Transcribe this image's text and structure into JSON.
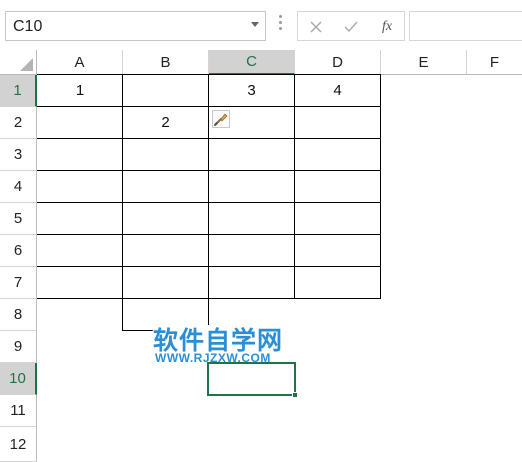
{
  "formula_bar": {
    "name_box_value": "C10",
    "fx_label": "fx",
    "formula_value": ""
  },
  "columns": [
    {
      "label": "A",
      "active": false
    },
    {
      "label": "B",
      "active": false
    },
    {
      "label": "C",
      "active": true
    },
    {
      "label": "D",
      "active": false
    },
    {
      "label": "E",
      "active": false
    },
    {
      "label": "F",
      "active": false
    }
  ],
  "rows": [
    {
      "label": "1",
      "active": true
    },
    {
      "label": "2",
      "active": false
    },
    {
      "label": "3",
      "active": false
    },
    {
      "label": "4",
      "active": false
    },
    {
      "label": "5",
      "active": false
    },
    {
      "label": "6",
      "active": false
    },
    {
      "label": "7",
      "active": false
    },
    {
      "label": "8",
      "active": false
    },
    {
      "label": "9",
      "active": false
    },
    {
      "label": "10",
      "active": true
    },
    {
      "label": "11",
      "active": false
    },
    {
      "label": "12",
      "active": false
    }
  ],
  "cells": {
    "A1": "1",
    "C1": "3",
    "D1": "4",
    "B2": "2"
  },
  "selected_cell": "C10",
  "watermark": {
    "title": "软件自学网",
    "url": "WWW.RJZXW.COM"
  },
  "colors": {
    "accent": "#217346",
    "watermark": "#2a8fd4"
  }
}
